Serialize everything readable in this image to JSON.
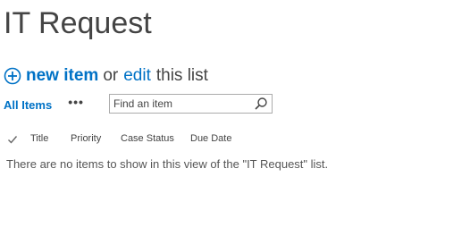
{
  "page": {
    "title": "IT Request"
  },
  "actions": {
    "new_item_label": "new item",
    "or_text": "or",
    "edit_label": "edit",
    "this_list_text": "this list"
  },
  "toolbar": {
    "view_label": "All Items",
    "more_label": "•••",
    "search_placeholder": "Find an item"
  },
  "list": {
    "columns": [
      "Title",
      "Priority",
      "Case Status",
      "Due Date"
    ],
    "empty_message": "There are no items to show in this view of the \"IT Request\" list."
  },
  "colors": {
    "accent": "#0072c6",
    "text": "#444444"
  },
  "icons": {
    "add": "plus-circle-icon",
    "search": "search-icon",
    "select": "checkmark-icon"
  }
}
